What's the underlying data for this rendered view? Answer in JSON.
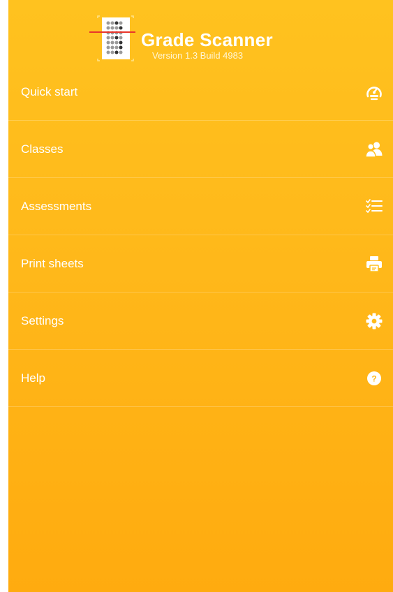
{
  "app": {
    "title": "Grade Scanner",
    "version": "Version 1.3 Build 4983"
  },
  "colors": {
    "background_top": "#ffc21f",
    "background_bottom": "#ffab0f",
    "text": "#ffffff",
    "logo_scan_line": "#e8352a"
  },
  "menu": {
    "items": [
      {
        "label": "Quick start",
        "icon": "speedometer-icon"
      },
      {
        "label": "Classes",
        "icon": "users-icon"
      },
      {
        "label": "Assessments",
        "icon": "checklist-icon"
      },
      {
        "label": "Print sheets",
        "icon": "printer-icon"
      },
      {
        "label": "Settings",
        "icon": "gear-icon"
      },
      {
        "label": "Help",
        "icon": "help-icon"
      }
    ]
  },
  "help_icon_glyph": "?"
}
